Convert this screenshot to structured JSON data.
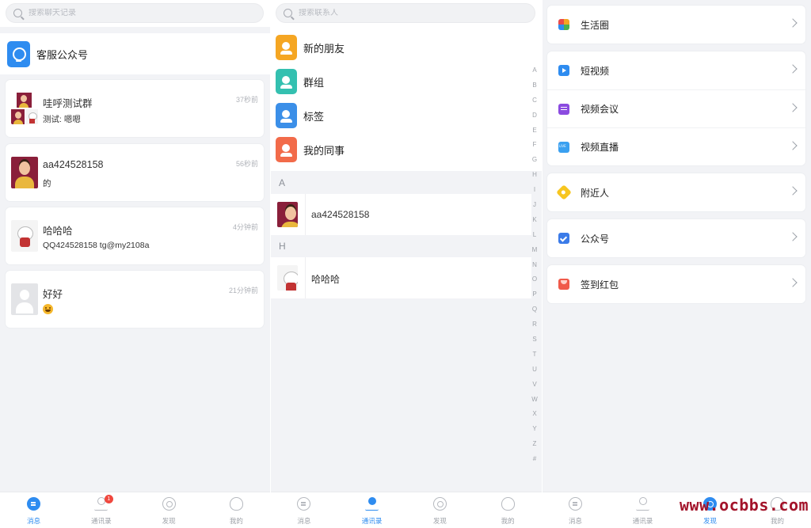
{
  "messages_panel": {
    "search_placeholder": "搜索聊天记录",
    "service_account_label": "客服公众号",
    "chats": [
      {
        "name": "哇呼测试群",
        "preview": "测试: 嗯嗯",
        "time": "37秒前"
      },
      {
        "name": "aa424528158",
        "preview": "的",
        "time": "56秒前"
      },
      {
        "name": "哈哈哈",
        "preview": "QQ424528158 tg@my2108a",
        "time": "4分钟前"
      },
      {
        "name": "好好",
        "preview": "",
        "preview_icon": "grin-emoji-icon",
        "time": "21分钟前"
      }
    ]
  },
  "contacts_panel": {
    "search_placeholder": "搜索联系人",
    "functions": [
      {
        "label": "新的朋友",
        "color": "#f5a623"
      },
      {
        "label": "群组",
        "color": "#34c0b0"
      },
      {
        "label": "标签",
        "color": "#3b8fe8"
      },
      {
        "label": "我的同事",
        "color": "#f26b4a"
      }
    ],
    "sections": [
      {
        "letter": "A",
        "contacts": [
          "aa424528158"
        ]
      },
      {
        "letter": "H",
        "contacts": [
          "哈哈哈"
        ]
      }
    ],
    "index_letters": [
      "A",
      "B",
      "C",
      "D",
      "E",
      "F",
      "G",
      "H",
      "I",
      "J",
      "K",
      "L",
      "M",
      "N",
      "O",
      "P",
      "Q",
      "R",
      "S",
      "T",
      "U",
      "V",
      "W",
      "X",
      "Y",
      "Z",
      "#"
    ]
  },
  "discover_panel": {
    "groups": [
      [
        {
          "label": "生活圈",
          "icon": "pinwheel-icon"
        }
      ],
      [
        {
          "label": "短视频",
          "icon": "play-video-icon"
        },
        {
          "label": "视频会议",
          "icon": "meeting-icon"
        },
        {
          "label": "视频直播",
          "icon": "live-icon"
        }
      ],
      [
        {
          "label": "附近人",
          "icon": "location-pin-icon"
        }
      ],
      [
        {
          "label": "公众号",
          "icon": "verified-badge-icon"
        }
      ],
      [
        {
          "label": "签到红包",
          "icon": "red-envelope-icon"
        }
      ]
    ]
  },
  "tabbars": [
    {
      "active": 0,
      "tabs": [
        {
          "label": "消息"
        },
        {
          "label": "通讯录",
          "badge": "1"
        },
        {
          "label": "发现"
        },
        {
          "label": "我的"
        }
      ]
    },
    {
      "active": 1,
      "tabs": [
        {
          "label": "消息"
        },
        {
          "label": "通讯录"
        },
        {
          "label": "发现"
        },
        {
          "label": "我的"
        }
      ]
    },
    {
      "active": 2,
      "tabs": [
        {
          "label": "消息"
        },
        {
          "label": "通讯录"
        },
        {
          "label": "发现"
        },
        {
          "label": "我的"
        }
      ]
    }
  ],
  "watermark": "www.ocbbs.com",
  "colors": {
    "accent": "#2e8cf0",
    "badge": "#f0483e",
    "watermark": "#a3132a"
  }
}
